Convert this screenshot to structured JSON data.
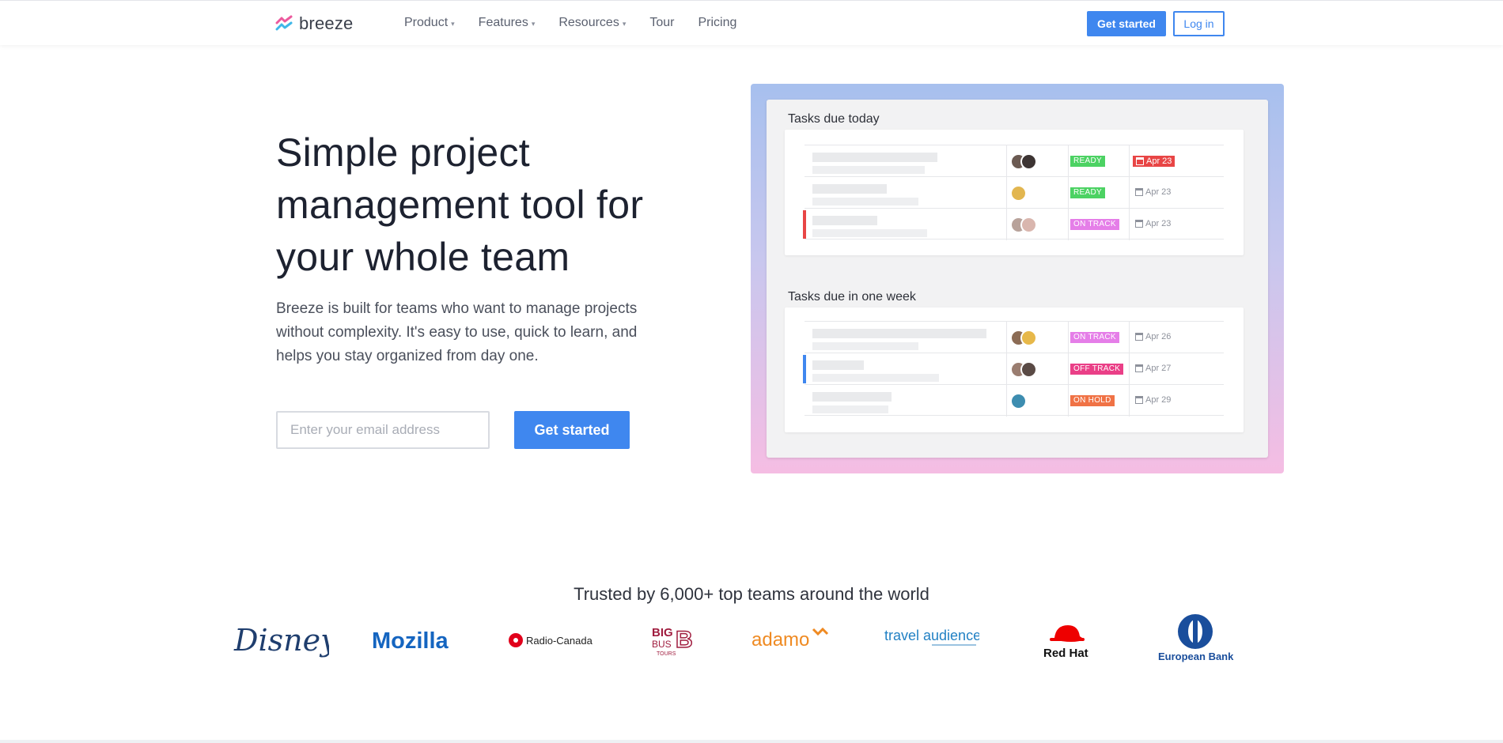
{
  "nav": {
    "logo_text": "breeze",
    "menu": [
      {
        "label": "Product",
        "dropdown": true
      },
      {
        "label": "Features",
        "dropdown": true
      },
      {
        "label": "Resources",
        "dropdown": true
      },
      {
        "label": "Tour",
        "dropdown": false
      },
      {
        "label": "Pricing",
        "dropdown": false
      }
    ],
    "cta_label": "Get started",
    "login_label": "Log in"
  },
  "hero": {
    "title": "Simple project management tool for your whole team",
    "subtitle": "Breeze is built for teams who want to manage projects without complexity. It's easy to use, quick to learn, and helps you stay organized from day one.",
    "email_placeholder": "Enter your email address",
    "cta_label": "Get started"
  },
  "mockup": {
    "sections": [
      {
        "title": "Tasks due today",
        "rows": [
          {
            "status": "READY",
            "status_color": "#4cd263",
            "date": "Apr 23",
            "overdue": true
          },
          {
            "status": "READY",
            "status_color": "#4cd263",
            "date": "Apr 23",
            "overdue": false
          },
          {
            "status": "ON TRACK",
            "status_color": "#e57ee8",
            "date": "Apr 23",
            "overdue": false
          }
        ]
      },
      {
        "title": "Tasks due in one week",
        "rows": [
          {
            "status": "ON TRACK",
            "status_color": "#e57ee8",
            "date": "Apr 26",
            "overdue": false
          },
          {
            "status": "OFF TRACK",
            "status_color": "#ea3f87",
            "date": "Apr 27",
            "overdue": false
          },
          {
            "status": "ON HOLD",
            "status_color": "#f07245",
            "date": "Apr 29",
            "overdue": false
          }
        ]
      }
    ]
  },
  "trusted": {
    "heading": "Trusted by 6,000+ top teams around the world",
    "logos": [
      "Disney",
      "Mozilla",
      "Radio-Canada",
      "Big Bus Tours",
      "adamo",
      "travel audience",
      "Red Hat",
      "European Bank"
    ]
  },
  "colors": {
    "accent": "#3f87ef",
    "ready": "#4cd263",
    "on_track": "#e57ee8",
    "off_track": "#ea3f87",
    "on_hold": "#f07245",
    "overdue": "#e84545"
  }
}
